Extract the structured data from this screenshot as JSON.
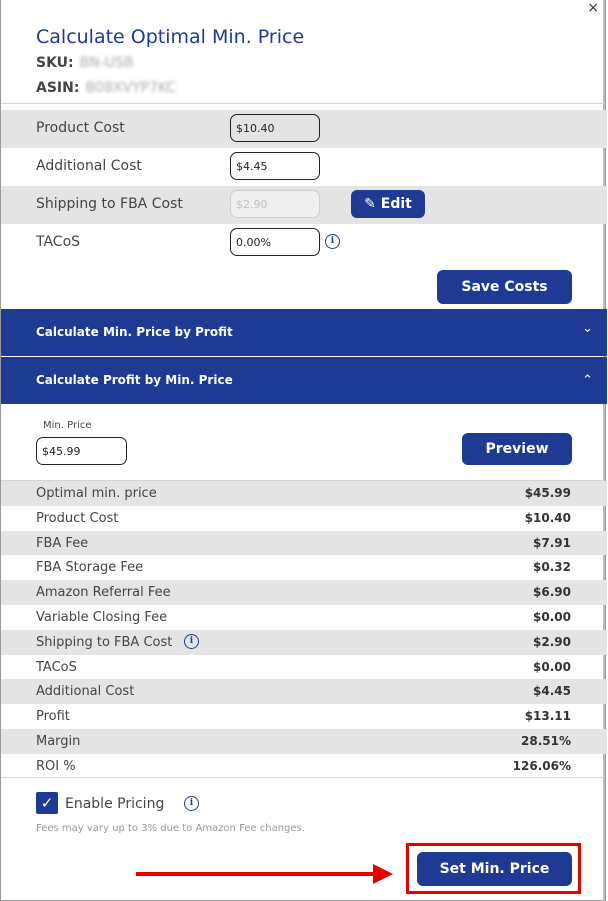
{
  "modal": {
    "title": "Calculate Optimal Min. Price",
    "sku_label": "SKU:",
    "sku_value": "BN-USB",
    "asin_label": "ASIN:",
    "asin_value": "B08XVYP7KC",
    "close_glyph": "×"
  },
  "costs": {
    "product_cost": {
      "label": "Product Cost",
      "value": "$10.40"
    },
    "additional_cost": {
      "label": "Additional Cost",
      "value": "$4.45"
    },
    "shipping_cost": {
      "label": "Shipping to FBA Cost",
      "value": "$2.90"
    },
    "tacos": {
      "label": "TACoS",
      "value": "0.00%"
    },
    "edit_label": "Edit",
    "save_label": "Save Costs"
  },
  "accordions": {
    "by_profit": {
      "label": "Calculate Min. Price by Profit",
      "chevron": "⌄"
    },
    "by_min_price": {
      "label": "Calculate Profit by Min. Price",
      "chevron": "⌃"
    }
  },
  "min_price": {
    "label": "Min. Price",
    "value": "$45.99",
    "preview_label": "Preview"
  },
  "breakdown": [
    {
      "label": "Optimal min. price",
      "value": "$45.99"
    },
    {
      "label": "Product Cost",
      "value": "$10.40"
    },
    {
      "label": "FBA Fee",
      "value": "$7.91"
    },
    {
      "label": "FBA Storage Fee",
      "value": "$0.32"
    },
    {
      "label": "Amazon Referral Fee",
      "value": "$6.90"
    },
    {
      "label": "Variable Closing Fee",
      "value": "$0.00"
    },
    {
      "label": "Shipping to FBA Cost",
      "value": "$2.90"
    },
    {
      "label": "TACoS",
      "value": "$0.00"
    },
    {
      "label": "Additional Cost",
      "value": "$4.45"
    },
    {
      "label": "Profit",
      "value": "$13.11"
    },
    {
      "label": "Margin",
      "value": "28.51%"
    },
    {
      "label": "ROI %",
      "value": "126.06%"
    }
  ],
  "footer": {
    "enable_pricing_label": "Enable Pricing",
    "enable_pricing_checked": true,
    "fees_note": "Fees may vary up to 3% due to Amazon Fee changes.",
    "set_min_price_label": "Set Min. Price"
  },
  "colors": {
    "accent": "#1f3a93",
    "highlight": "#e60000",
    "shaded_row": "#e4e4e4"
  },
  "icons": {
    "info": "i",
    "pencil": "✎",
    "check": "✓"
  }
}
